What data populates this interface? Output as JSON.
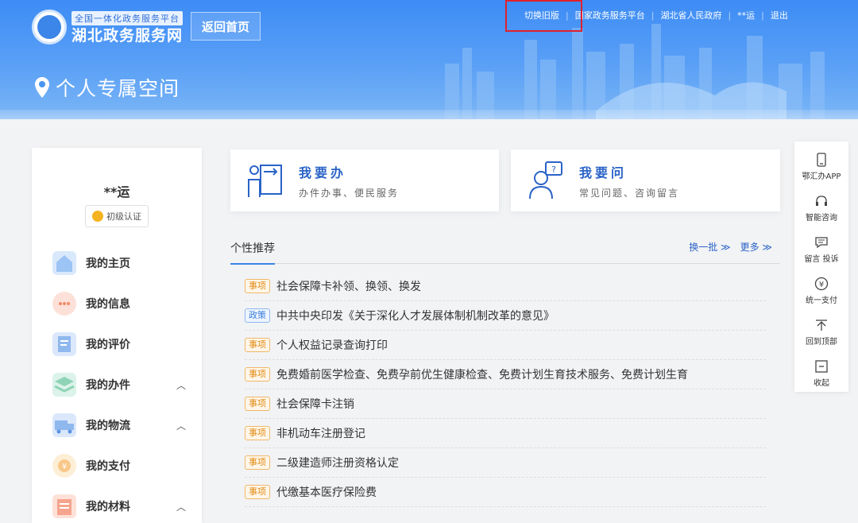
{
  "header": {
    "slogan": "全国一体化政务服务平台",
    "site_title": "湖北政务服务网",
    "home_button": "返回首页",
    "space_title": "个人专属空间",
    "topnav": [
      "切换旧版",
      "国家政务服务平台",
      "湖北省人民政府",
      "**运",
      "退出"
    ]
  },
  "sidebar": {
    "username": "**运",
    "cert_label": "初级认证",
    "menu": [
      {
        "label": "我的主页",
        "icon": "home-icon",
        "color": "#9cc4f4"
      },
      {
        "label": "我的信息",
        "icon": "chat-icon",
        "color": "#f6a48d"
      },
      {
        "label": "我的评价",
        "icon": "document-icon",
        "color": "#8fb8ef"
      },
      {
        "label": "我的办件",
        "icon": "layers-icon",
        "color": "#8fd3b6"
      },
      {
        "label": "我的物流",
        "icon": "truck-icon",
        "color": "#8fb8ef"
      },
      {
        "label": "我的支付",
        "icon": "payment-icon",
        "color": "#f8c88a"
      },
      {
        "label": "我的材料",
        "icon": "folder-icon",
        "color": "#f6a48d"
      }
    ]
  },
  "cards": [
    {
      "title": "我要办",
      "subtitle": "办件办事、便民服务"
    },
    {
      "title": "我要问",
      "subtitle": "常见问题、咨询留言"
    }
  ],
  "recommend": {
    "title": "个性推荐",
    "refresh": "换一批 ≫",
    "more": "更多 ≫",
    "items": [
      {
        "tag": "事项",
        "type": "item",
        "text": "社会保障卡补领、换领、换发"
      },
      {
        "tag": "政策",
        "type": "policy",
        "text": "中共中央印发《关于深化人才发展体制机制改革的意见》"
      },
      {
        "tag": "事项",
        "type": "item",
        "text": "个人权益记录查询打印"
      },
      {
        "tag": "事项",
        "type": "item",
        "text": "免费婚前医学检查、免费孕前优生健康检查、免费计划生育技术服务、免费计划生育"
      },
      {
        "tag": "事项",
        "type": "item",
        "text": "社会保障卡注销"
      },
      {
        "tag": "事项",
        "type": "item",
        "text": "非机动车注册登记"
      },
      {
        "tag": "事项",
        "type": "item",
        "text": "二级建造师注册资格认定"
      },
      {
        "tag": "事项",
        "type": "item",
        "text": "代缴基本医疗保险费"
      }
    ]
  },
  "rightbar": [
    {
      "label": "鄂汇办APP",
      "icon": "phone-icon"
    },
    {
      "label": "智能咨询",
      "icon": "headset-icon"
    },
    {
      "label": "留言 投诉",
      "icon": "message-icon"
    },
    {
      "label": "统一支付",
      "icon": "yen-icon"
    },
    {
      "label": "回到顶部",
      "icon": "back-to-top-icon"
    },
    {
      "label": "收起",
      "icon": "collapse-icon"
    }
  ]
}
